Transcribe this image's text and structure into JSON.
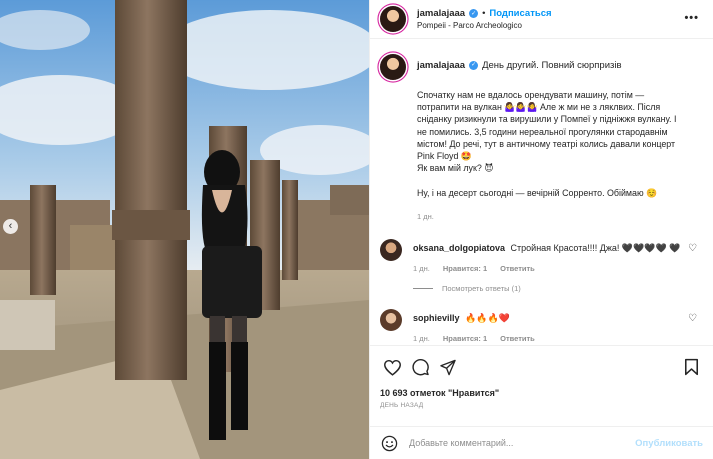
{
  "post": {
    "username": "jamalajaaa",
    "follow_label": "Подписаться",
    "dot": "•",
    "location": "Pompeii - Parco Archeologico",
    "more_label": "•••",
    "prev_label": "‹"
  },
  "caption": {
    "username": "jamalajaaa",
    "title": "День другий. Повний сюрпризів",
    "lines": [
      "Спочатку нам не вдалось орендувати машину, потім —",
      "потрапити на вулкан 🤷‍♀️🤷‍♀️🤷‍♀️ Але ж ми не з ляклвих. Після",
      "сніданку ризикнули та вирушили у Помпеї у підніжжя вулкану. І",
      "не помились. 3,5 години нереальної прогулянки стародавнім",
      "містом! До речі, тут в античному театрі колись давали концерт",
      "Pink Floyd 🤩",
      "Як вам мій лук? 😈",
      "Ну, і на десерт сьогодні — вечірній Сорренто. Обіймаю ☺️"
    ],
    "time": "1 дн."
  },
  "comments": [
    {
      "username": "oksana_dolgopiatova",
      "text": "Стройная Красота!!!! Джа! 🖤🖤🖤🖤 🖤",
      "time": "1 дн.",
      "likes": "Нравится: 1",
      "reply": "Ответить"
    },
    {
      "username": "sophievilly",
      "text": "🔥🔥🔥❤️",
      "time": "1 дн.",
      "likes": "Нравится: 1",
      "reply": "Ответить"
    }
  ],
  "view_replies": "Посмотреть ответы (1)",
  "likes_count": "10 693 отметок \"Нравится\"",
  "posted_ago": "ДЕНЬ НАЗАД",
  "add_comment": {
    "placeholder": "Добавьте комментарий...",
    "publish_label": "Опубликовать"
  },
  "colors": {
    "accent": "#0095f6",
    "publish_disabled": "#b2dffc",
    "muted": "#8e8e8e",
    "text": "#262626"
  },
  "icons": [
    "heart-icon",
    "comment-icon",
    "share-icon",
    "bookmark-icon",
    "smile-icon",
    "verified-icon",
    "more-icon"
  ]
}
